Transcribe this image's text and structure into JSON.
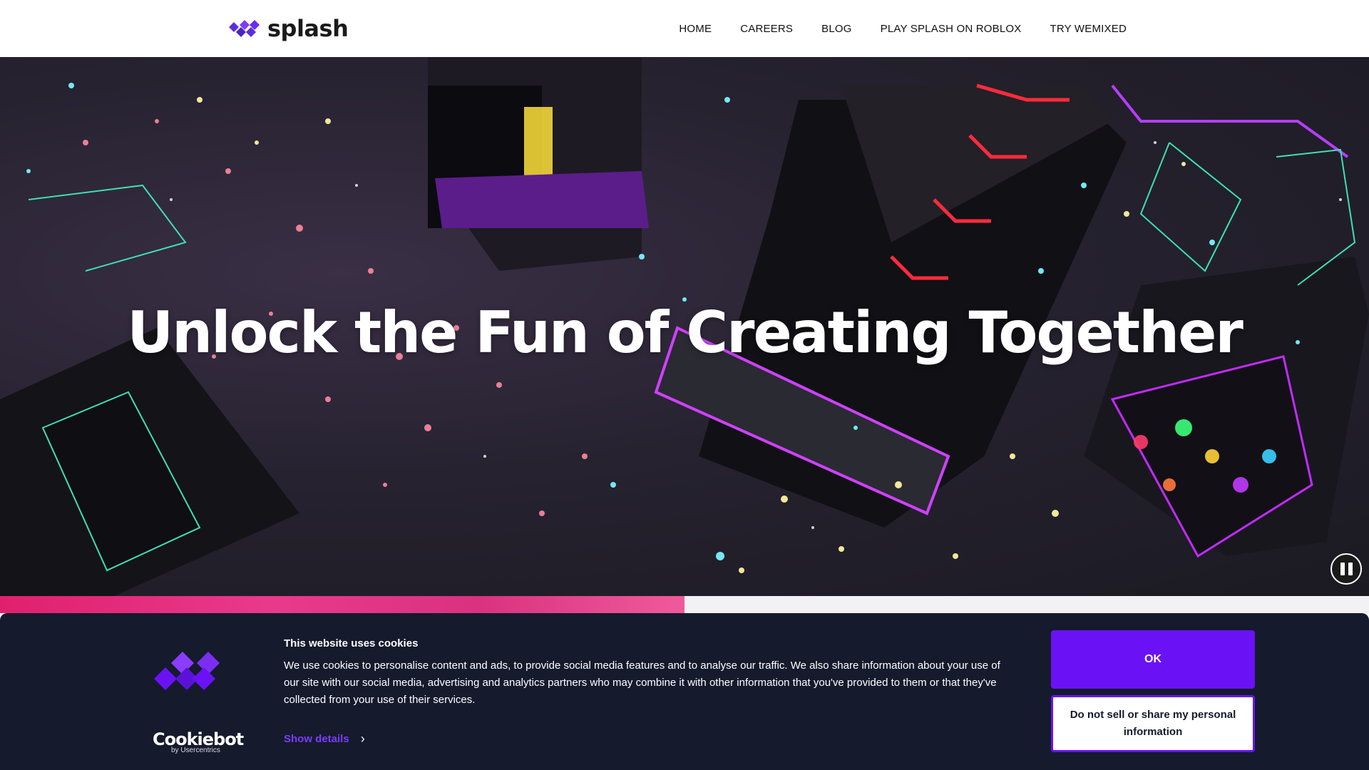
{
  "header": {
    "logo_text": "splash",
    "nav": [
      "HOME",
      "CAREERS",
      "BLOG",
      "PLAY SPLASH ON ROBLOX",
      "TRY WEMIXED"
    ]
  },
  "hero": {
    "title": "Unlock the Fun of Creating Together",
    "video_progress": 0.5
  },
  "cookie_banner": {
    "title": "This website uses cookies",
    "text": "We use cookies to personalise content and ads, to provide social media features and to analyse our traffic. We also share information about your use of our site with our social media, advertising and analytics partners who may combine it with other information that you've provided to them or that they've collected from your use of their services.",
    "show_details": "Show details",
    "brand_name": "Cookiebot",
    "brand_sub": "by Usercentrics",
    "ok_label": "OK",
    "dns_label": "Do not sell or share my personal information"
  },
  "colors": {
    "brand_purple": "#6a12f5",
    "banner_bg": "#151a2d",
    "progress_pink": "#e0206e"
  },
  "icons": [
    "splash-logo-icon",
    "pause-icon",
    "chevron-right-icon",
    "cookiebot-logo-icon"
  ]
}
